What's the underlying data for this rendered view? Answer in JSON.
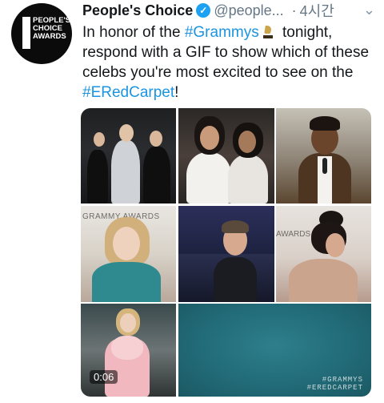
{
  "tweet": {
    "author": {
      "display_name": "People's Choice",
      "handle": "@people...",
      "verified": true,
      "avatar_text": [
        "PEOPLE'S",
        "CHOICE",
        "AWARDS"
      ]
    },
    "time": "4시간",
    "separator": "·",
    "text": {
      "part1": "In honor of the ",
      "hashtag1": "#Grammys",
      "part2": " tonight, respond with a GIF to show which of these celebs you're most excited to see on the ",
      "hashtag2": "#ERedCarpet",
      "part3": "!"
    },
    "media": {
      "type": "gif",
      "duration": "0:06",
      "banner_text_1": "GRAMMY AWARDS",
      "banner_text_2": "AWARDS",
      "watermark": [
        "#GRAMMYS",
        "#EREDCARPET"
      ]
    }
  },
  "colors": {
    "hashtag": "#1b95e0",
    "verified": "#1da1f2",
    "text": "#14171a",
    "secondary": "#657786"
  },
  "icons": {
    "verified": "check",
    "menu": "chevron-down",
    "emoji": "trophy"
  }
}
